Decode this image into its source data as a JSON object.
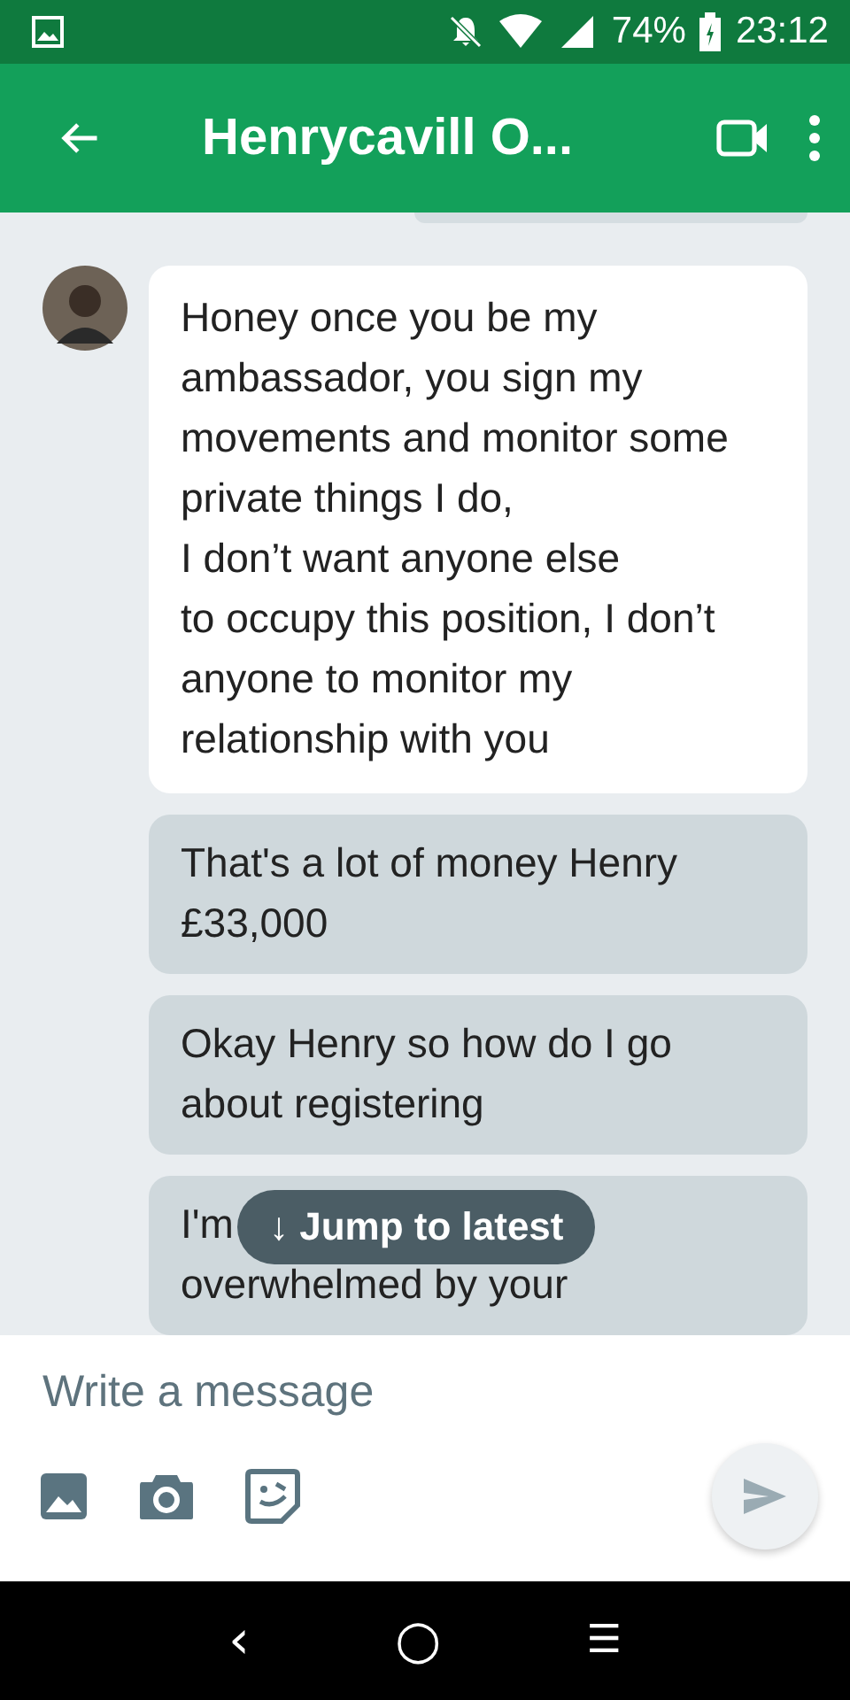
{
  "status_bar": {
    "battery": "74%",
    "time": "23:12"
  },
  "header": {
    "title": "Henrycavill O..."
  },
  "messages": [
    {
      "kind": "incoming",
      "text": "Honey once you be my ambassador, you sign my movements and monitor some private things I do,\nI don’t want anyone else\nto occupy this position, I don’t anyone to monitor my relationship with you"
    },
    {
      "kind": "outgoing",
      "text": "That's a lot of money Henry\n£33,000"
    },
    {
      "kind": "outgoing",
      "text": "Okay Henry so how do I go about registering"
    },
    {
      "kind": "outgoing",
      "text": "I'm\noverwhelmed by your"
    }
  ],
  "jump_button": {
    "label": "↓ Jump to latest"
  },
  "composer": {
    "placeholder": "Write a message"
  },
  "nav_bar": {
    "back": "‹",
    "home": "○",
    "menu": "☰"
  }
}
